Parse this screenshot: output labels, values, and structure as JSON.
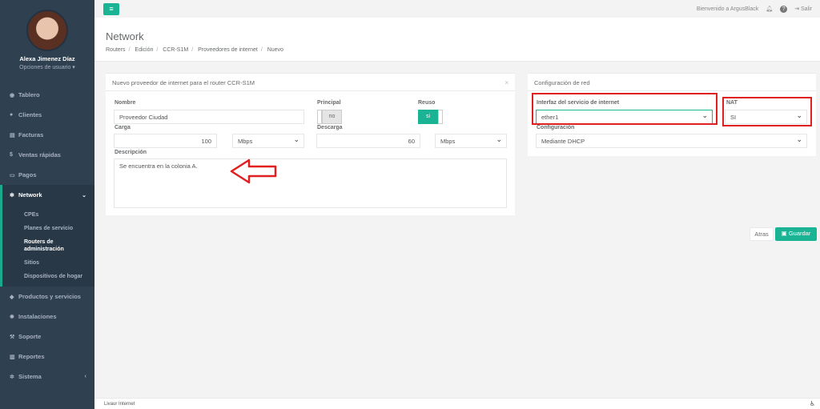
{
  "user": {
    "name": "Alexa Jimenez Díaz",
    "options": "Opciones de usuario ▾"
  },
  "sidebar": {
    "items": [
      {
        "label": "Tablero",
        "icon": "dashboard-icon"
      },
      {
        "label": "Clientes",
        "icon": "users-icon"
      },
      {
        "label": "Facturas",
        "icon": "file-icon"
      },
      {
        "label": "Ventas rápidas",
        "icon": "dollar-icon"
      },
      {
        "label": "Pagos",
        "icon": "money-icon"
      },
      {
        "label": "Network",
        "icon": "snowflake-icon"
      },
      {
        "label": "Productos y servicios",
        "icon": "tag-icon"
      },
      {
        "label": "Instalaciones",
        "icon": "gear-icon"
      },
      {
        "label": "Soporte",
        "icon": "wrench-icon"
      },
      {
        "label": "Reportes",
        "icon": "book-icon"
      },
      {
        "label": "Sistema",
        "icon": "cogs-icon"
      }
    ],
    "submenu": [
      "CPEs",
      "Planes de servicio",
      "Routers de administración",
      "Sitios",
      "Dispositivos de hogar"
    ]
  },
  "topbar": {
    "welcome": "Bienvenido a ArgusBlack",
    "logout": "Salir"
  },
  "page": {
    "title": "Network",
    "breadcrumb": [
      "Routers",
      "Edición",
      "CCR-S1M",
      "Proveedores de internet",
      "Nuevo"
    ]
  },
  "form": {
    "title": "Nuevo proveedor de internet para el router CCR-S1M",
    "nombre_label": "Nombre",
    "nombre_value": "Proveedor Ciudad",
    "principal_label": "Principal",
    "principal_value": "no",
    "reuso_label": "Reuso",
    "reuso_value": "si",
    "carga_label": "Carga",
    "carga_value": "100",
    "carga_unit": "Mbps",
    "descarga_label": "Descarga",
    "descarga_value": "60",
    "descarga_unit": "Mbps",
    "descripcion_label": "Descripción",
    "descripcion_value": "Se encuentra en la colonia A."
  },
  "network": {
    "title": "Configuración de red",
    "interfaz_label": "Interfaz del servicio de internet",
    "interfaz_value": "ether1",
    "nat_label": "NAT",
    "nat_value": "SI",
    "config_label": "Configuración",
    "config_value": "Mediante DHCP"
  },
  "actions": {
    "back": "Atras",
    "save": "Guardar"
  },
  "footer": {
    "text": "Livaur Internet"
  },
  "colors": {
    "accent": "#1ab394",
    "sidebar": "#2f4050",
    "highlight": "#e02020"
  }
}
